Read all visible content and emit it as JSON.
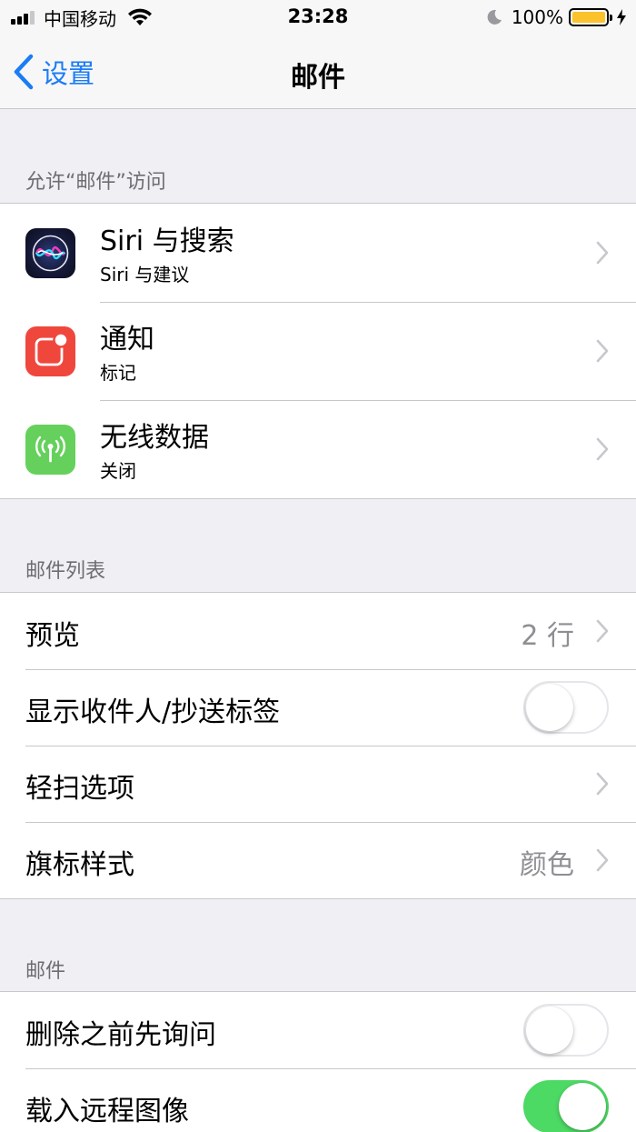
{
  "status_bar": {
    "carrier": "中国移动",
    "time": "23:28",
    "battery_percent": "100%",
    "battery_level": 1.0,
    "battery_color": "#fcc22d"
  },
  "nav": {
    "back_label": "设置",
    "title": "邮件",
    "accent": "#1b7cf6"
  },
  "sections": {
    "access": {
      "header": "允许“邮件”访问",
      "items": [
        {
          "title": "Siri 与搜索",
          "subtitle": "Siri 与建议",
          "icon": "siri-icon"
        },
        {
          "title": "通知",
          "subtitle": "标记",
          "icon": "notifications-icon",
          "icon_color": "#f0473d"
        },
        {
          "title": "无线数据",
          "subtitle": "关闭",
          "icon": "cellular-data-icon",
          "icon_color": "#65d15c"
        }
      ]
    },
    "mail_list": {
      "header": "邮件列表",
      "preview": {
        "label": "预览",
        "value": "2 行"
      },
      "show_to_cc": {
        "label": "显示收件人/抄送标签",
        "on": false
      },
      "swipe_options": {
        "label": "轻扫选项"
      },
      "flag_style": {
        "label": "旗标样式",
        "value": "颜色"
      }
    },
    "mail": {
      "header": "邮件",
      "ask_before_delete": {
        "label": "删除之前先询问",
        "on": false
      },
      "load_remote_images": {
        "label": "载入远程图像",
        "on": true
      },
      "toggle_on_color": "#4cd964"
    }
  }
}
